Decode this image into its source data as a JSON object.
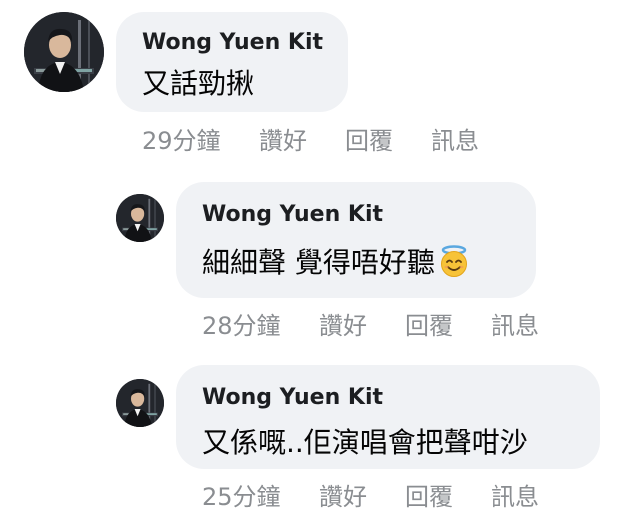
{
  "comments": [
    {
      "author": "Wong Yuen Kit",
      "text": "又話勁揪",
      "emoji": "",
      "time": "29分鐘",
      "like": "讚好",
      "reply": "回覆",
      "message": "訊息"
    },
    {
      "author": "Wong Yuen Kit",
      "text": "細細聲 覺得唔好聽",
      "emoji": "smiling-face-with-halo-icon",
      "time": "28分鐘",
      "like": "讚好",
      "reply": "回覆",
      "message": "訊息"
    },
    {
      "author": "Wong Yuen Kit",
      "text": "又係嘅..佢演唱會把聲咁沙",
      "emoji": "",
      "time": "25分鐘",
      "like": "讚好",
      "reply": "回覆",
      "message": "訊息"
    }
  ],
  "colors": {
    "bubble": "#f0f2f5",
    "author": "#1c1e21",
    "text": "#050505",
    "meta": "#8a8d91"
  }
}
